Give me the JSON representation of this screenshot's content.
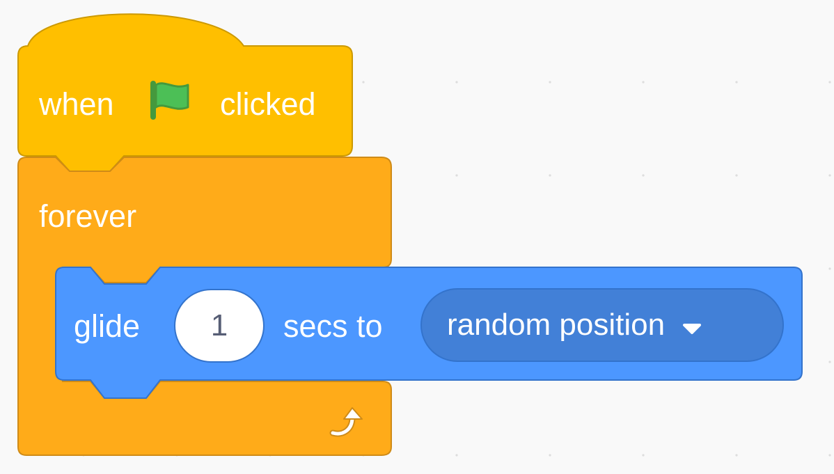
{
  "workspace": {
    "background_color": "#f9f9f9",
    "grid_dot_color": "#dddddd"
  },
  "hat_block": {
    "category": "events",
    "color": "#ffbf00",
    "border_color": "#cc9900",
    "label_before": "when",
    "icon": "green-flag-icon",
    "icon_color": "#4cbf56",
    "label_after": "clicked"
  },
  "forever_block": {
    "category": "control",
    "color": "#ffab19",
    "border_color": "#cf8b17",
    "label": "forever",
    "loop_icon": "loop-arrow-icon"
  },
  "glide_block": {
    "category": "motion",
    "color": "#4c97ff",
    "border_color": "#3373cc",
    "label_before": "glide",
    "secs_value": "1",
    "label_middle": "secs to",
    "target_value": "random position",
    "dropdown_icon": "dropdown-arrow-icon"
  }
}
